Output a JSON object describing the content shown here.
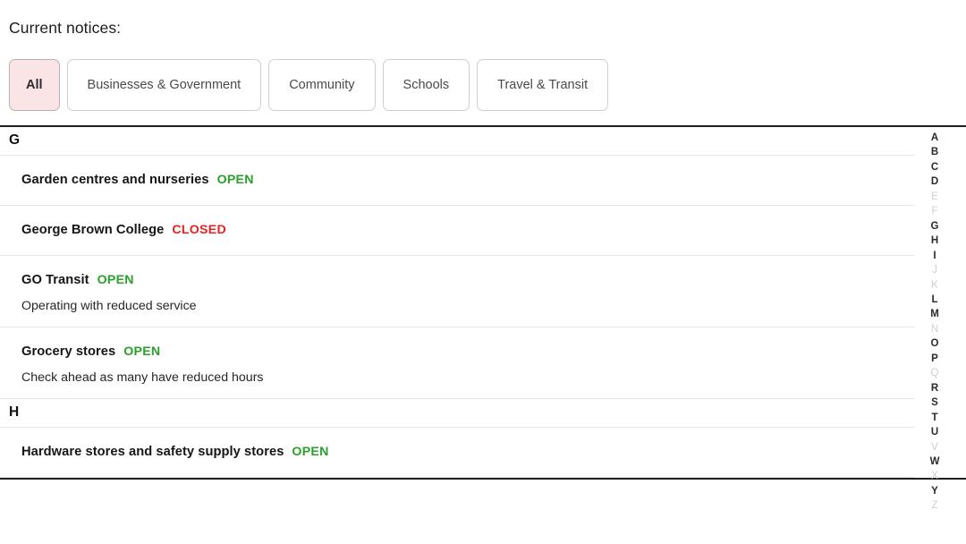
{
  "header": {
    "title": "Current notices:"
  },
  "filters": {
    "items": [
      {
        "label": "All",
        "active": true
      },
      {
        "label": "Businesses & Government",
        "active": false
      },
      {
        "label": "Community",
        "active": false
      },
      {
        "label": "Schools",
        "active": false
      },
      {
        "label": "Travel & Transit",
        "active": false
      }
    ]
  },
  "notices": {
    "sections": [
      {
        "letter": "G",
        "entries": [
          {
            "name": "Garden centres and nurseries",
            "status": "OPEN",
            "status_type": "open",
            "note": ""
          },
          {
            "name": "George Brown College",
            "status": "CLOSED",
            "status_type": "closed",
            "note": ""
          },
          {
            "name": "GO Transit",
            "status": "OPEN",
            "status_type": "open",
            "note": "Operating with reduced service"
          },
          {
            "name": "Grocery stores",
            "status": "OPEN",
            "status_type": "open",
            "note": "Check ahead as many have reduced hours"
          }
        ]
      },
      {
        "letter": "H",
        "entries": [
          {
            "name": "Hardware stores and safety supply stores",
            "status": "OPEN",
            "status_type": "open",
            "note": ""
          }
        ]
      }
    ]
  },
  "alphabet_index": {
    "letters": [
      {
        "letter": "A",
        "enabled": true
      },
      {
        "letter": "B",
        "enabled": true
      },
      {
        "letter": "C",
        "enabled": true
      },
      {
        "letter": "D",
        "enabled": true
      },
      {
        "letter": "E",
        "enabled": false
      },
      {
        "letter": "F",
        "enabled": false
      },
      {
        "letter": "G",
        "enabled": true
      },
      {
        "letter": "H",
        "enabled": true
      },
      {
        "letter": "I",
        "enabled": true
      },
      {
        "letter": "J",
        "enabled": false
      },
      {
        "letter": "K",
        "enabled": false
      },
      {
        "letter": "L",
        "enabled": true
      },
      {
        "letter": "M",
        "enabled": true
      },
      {
        "letter": "N",
        "enabled": false
      },
      {
        "letter": "O",
        "enabled": true
      },
      {
        "letter": "P",
        "enabled": true
      },
      {
        "letter": "Q",
        "enabled": false
      },
      {
        "letter": "R",
        "enabled": true
      },
      {
        "letter": "S",
        "enabled": true
      },
      {
        "letter": "T",
        "enabled": true
      },
      {
        "letter": "U",
        "enabled": true
      },
      {
        "letter": "V",
        "enabled": false
      },
      {
        "letter": "W",
        "enabled": true
      },
      {
        "letter": "X",
        "enabled": false
      },
      {
        "letter": "Y",
        "enabled": true
      },
      {
        "letter": "Z",
        "enabled": false
      }
    ]
  },
  "colors": {
    "open": "#2aa02a",
    "closed": "#e8221f",
    "active_filter_bg": "#fbe4e6",
    "rule": "#1e1e1e",
    "separator": "#e6e6e6",
    "disabled_letter": "#cfcfcf"
  }
}
